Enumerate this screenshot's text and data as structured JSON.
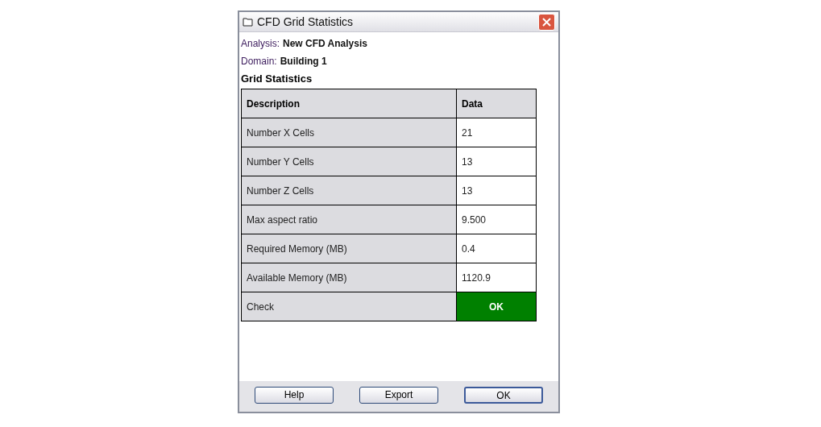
{
  "window": {
    "title": "CFD Grid Statistics"
  },
  "analysis": {
    "label": "Analysis:",
    "value": "New CFD Analysis"
  },
  "domain": {
    "label": "Domain:",
    "value": "Building 1"
  },
  "section_title": "Grid Statistics",
  "table": {
    "columns": [
      "Description",
      "Data"
    ],
    "rows": [
      {
        "kind": "value",
        "description": "Number X Cells",
        "data": "21"
      },
      {
        "kind": "value",
        "description": "Number Y Cells",
        "data": "13"
      },
      {
        "kind": "value",
        "description": "Number Z Cells",
        "data": "13"
      },
      {
        "kind": "value",
        "description": "Max aspect ratio",
        "data": "9.500"
      },
      {
        "kind": "value",
        "description": "Required Memory (MB)",
        "data": "0.4"
      },
      {
        "kind": "value",
        "description": "Available Memory (MB)",
        "data": "1120.9"
      },
      {
        "kind": "status",
        "description": "Check",
        "data": "OK",
        "color": "#008000"
      }
    ]
  },
  "buttons": [
    {
      "label": "Help",
      "default": false
    },
    {
      "label": "Export",
      "default": false
    },
    {
      "label": "OK",
      "default": true
    }
  ]
}
